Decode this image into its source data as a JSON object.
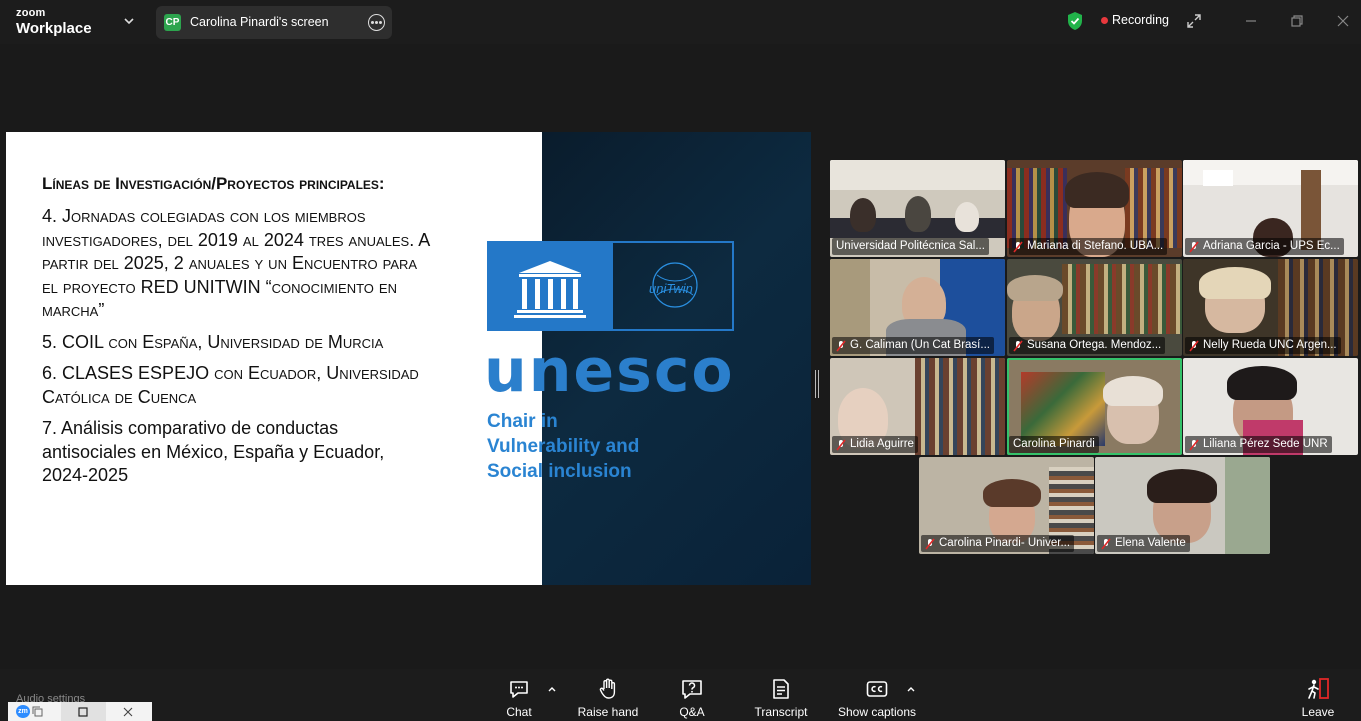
{
  "titlebar": {
    "brand_line1": "zoom",
    "brand_line2": "Workplace",
    "share_badge": "CP",
    "share_label": "Carolina Pinardi's screen",
    "recording_label": "Recording"
  },
  "slide": {
    "heading": "Líneas de Investigación/Proyectos principales:",
    "items": [
      "4. Jornadas colegiadas con los miembros investigadores, del 2019 al 2024 tres anuales. A partir del 2025, 2 anuales y un Encuentro para el proyecto RED UNITWIN “conocimiento en marcha”",
      "5. COIL con España, Universidad de Murcia",
      "6. CLASES ESPEJO con Ecuador, Universidad Católica de Cuenca",
      "7. Análisis comparativo de conductas antisociales en México, España y Ecuador, 2024-2025"
    ],
    "logo_left_text": "UNESCO",
    "unitwin_text": "uniTwin",
    "brand_word": "unesco",
    "chair_lines": [
      "Chair in",
      "Vulnerability and",
      "Social inclusion"
    ]
  },
  "gallery": {
    "participants": [
      {
        "name": "Universidad Politécnica Sal...",
        "muted": false
      },
      {
        "name": "Mariana di Stefano. UBA...",
        "muted": true
      },
      {
        "name": "Adriana Garcia - UPS Ec...",
        "muted": true
      },
      {
        "name": "G. Caliman (Un Cat Brasí...",
        "muted": true
      },
      {
        "name": "Susana Ortega. Mendoz...",
        "muted": true
      },
      {
        "name": "Nelly Rueda UNC Argen...",
        "muted": true
      },
      {
        "name": "Lidia Aguirre",
        "muted": true
      },
      {
        "name": "Carolina Pinardi",
        "muted": false
      },
      {
        "name": "Liliana Pérez Sede UNR",
        "muted": true
      },
      {
        "name": "Carolina Pinardi- Univer...",
        "muted": true
      },
      {
        "name": "Elena Valente",
        "muted": true
      }
    ]
  },
  "toolbar": {
    "audio_settings": "Audio settings",
    "chat": "Chat",
    "raise_hand": "Raise hand",
    "qa": "Q&A",
    "transcript": "Transcript",
    "show_captions": "Show captions",
    "leave": "Leave"
  },
  "taskbar": {
    "app_icon_text": "zm"
  },
  "colors": {
    "accent_blue": "#2b7fcc",
    "active_speaker": "#35c26a",
    "recording_red": "#e8383d",
    "leave_red": "#e02828"
  }
}
